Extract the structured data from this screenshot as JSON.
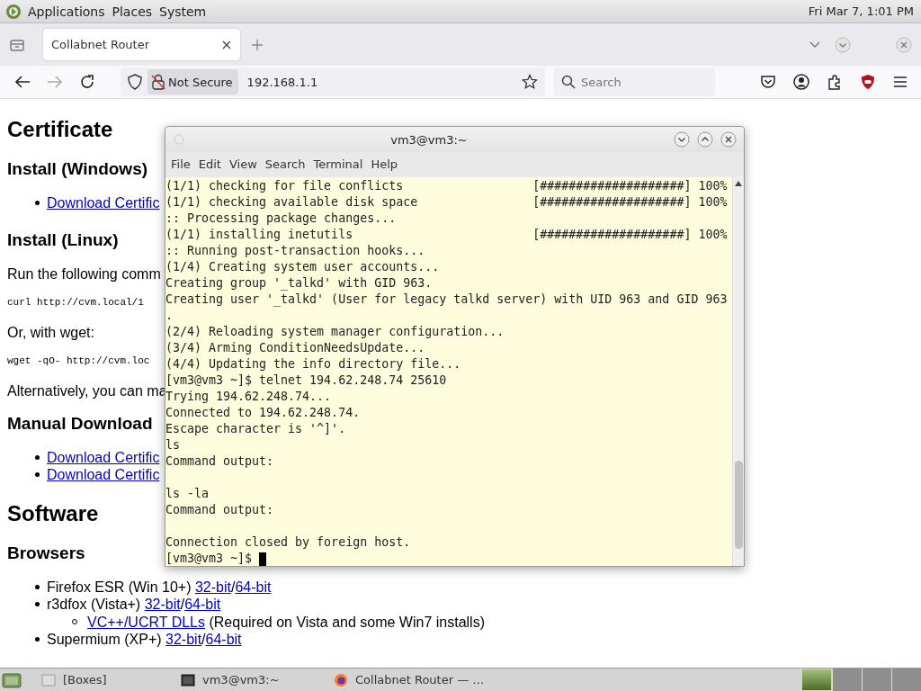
{
  "top_panel": {
    "menus": [
      "Applications",
      "Places",
      "System"
    ],
    "clock": "Fri Mar 7, 1:01 PM"
  },
  "browser": {
    "tabs": [
      {
        "title": "Collabnet Router",
        "selected": true
      }
    ],
    "address": {
      "security": "Not Secure",
      "url": "192.168.1.1"
    },
    "search": {
      "placeholder": "Search"
    }
  },
  "page": {
    "blocks": [
      {
        "kind": "h1",
        "text": "Certificate"
      },
      {
        "kind": "h2",
        "text": "Install (Windows)"
      },
      {
        "kind": "list",
        "items": [
          {
            "parts": [
              {
                "text": "Download Certific",
                "link": true
              }
            ]
          }
        ]
      },
      {
        "kind": "h2",
        "text": "Install (Linux)"
      },
      {
        "kind": "p",
        "text": "Run the following comm"
      },
      {
        "kind": "code",
        "text": "curl http://cvm.local/1"
      },
      {
        "kind": "p",
        "text": "Or, with wget:"
      },
      {
        "kind": "code",
        "text": "wget -qO- http://cvm.loc"
      },
      {
        "kind": "p",
        "text": "Alternatively, you can ma"
      },
      {
        "kind": "h2",
        "text": "Manual Download"
      },
      {
        "kind": "list",
        "items": [
          {
            "parts": [
              {
                "text": "Download Certific",
                "link": true
              }
            ]
          },
          {
            "parts": [
              {
                "text": "Download Certific",
                "link": true
              }
            ]
          }
        ]
      },
      {
        "kind": "h1",
        "text": "Software"
      },
      {
        "kind": "h2",
        "text": "Browsers"
      },
      {
        "kind": "list",
        "items": [
          {
            "parts": [
              {
                "text": "Firefox ESR (Win 10+) ",
                "link": false
              },
              {
                "text": "32-bit",
                "link": true
              },
              {
                "text": "/",
                "link": false
              },
              {
                "text": "64-bit",
                "link": true
              }
            ]
          },
          {
            "parts": [
              {
                "text": "r3dfox (Vista+) ",
                "link": false
              },
              {
                "text": "32-bit",
                "link": true
              },
              {
                "text": "/",
                "link": false
              },
              {
                "text": "64-bit",
                "link": true
              }
            ],
            "children": [
              {
                "parts": [
                  {
                    "text": "VC++/UCRT DLLs",
                    "link": true
                  },
                  {
                    "text": " (Required on Vista and some Win7 installs)",
                    "link": false
                  }
                ]
              }
            ]
          },
          {
            "parts": [
              {
                "text": "Supermium (XP+) ",
                "link": false
              },
              {
                "text": "32-bit",
                "link": true
              },
              {
                "text": "/",
                "link": false
              },
              {
                "text": "64-bit",
                "link": true
              }
            ]
          }
        ]
      }
    ]
  },
  "terminal": {
    "title": "vm3@vm3:~",
    "menu": [
      "File",
      "Edit",
      "View",
      "Search",
      "Terminal",
      "Help"
    ],
    "lines": [
      {
        "text": "(1/1) checking for file conflicts                  [####################] 100%"
      },
      {
        "text": "(1/1) checking available disk space                [####################] 100%"
      },
      {
        "text": ":: Processing package changes..."
      },
      {
        "text": "(1/1) installing inetutils                         [####################] 100%"
      },
      {
        "text": ":: Running post-transaction hooks..."
      },
      {
        "text": "(1/4) Creating system user accounts..."
      },
      {
        "text": "Creating group '_talkd' with GID 963."
      },
      {
        "text": "Creating user '_talkd' (User for legacy talkd server) with UID 963 and GID 963"
      },
      {
        "text": "."
      },
      {
        "text": "(2/4) Reloading system manager configuration..."
      },
      {
        "text": "(3/4) Arming ConditionNeedsUpdate..."
      },
      {
        "text": "(4/4) Updating the info directory file..."
      },
      {
        "text": "[vm3@vm3 ~]$ telnet 194.62.248.74 25610"
      },
      {
        "text": "Trying 194.62.248.74..."
      },
      {
        "text": "Connected to 194.62.248.74."
      },
      {
        "text": "Escape character is '^]'."
      },
      {
        "text": "ls"
      },
      {
        "text": "Command output:"
      },
      {
        "text": "ls -la",
        "gap_before": true
      },
      {
        "text": "Command output:"
      },
      {
        "text": "Connection closed by foreign host.",
        "gap_before": true
      }
    ],
    "prompt": "[vm3@vm3 ~]$"
  },
  "taskbar": {
    "items": [
      {
        "label": "[Boxes]",
        "kind": "folder"
      },
      {
        "label": "vm3@vm3:~",
        "kind": "terminal"
      },
      {
        "label": "Collabnet Router — …",
        "kind": "browser"
      }
    ]
  }
}
